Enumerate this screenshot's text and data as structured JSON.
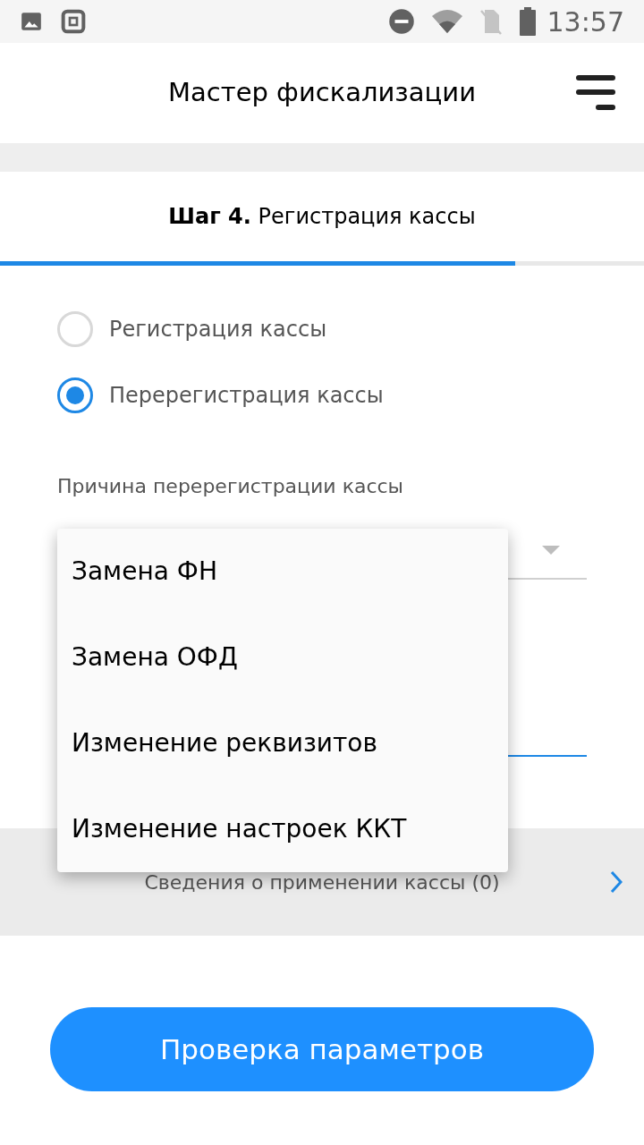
{
  "status_bar": {
    "time": "13:57"
  },
  "header": {
    "title": "Мастер фискализации"
  },
  "step": {
    "title": "**Шаг 4.** Регистрация кассы",
    "level": 0.8
  },
  "radios": [
    {
      "label": "Регистрация кассы",
      "selected": false
    },
    {
      "label": "Перерегистрация кассы",
      "selected": true
    }
  ],
  "reason_field": {
    "label": "Причина перерегистрации кассы"
  },
  "menu": {
    "items": [
      "Замена ФН",
      "Замена ОФД",
      "Изменение реквизитов",
      "Изменение настроек ККТ"
    ]
  },
  "info_row": {
    "label": "Сведения о применении кассы (0)"
  },
  "button": {
    "label": "Проверка параметров"
  }
}
